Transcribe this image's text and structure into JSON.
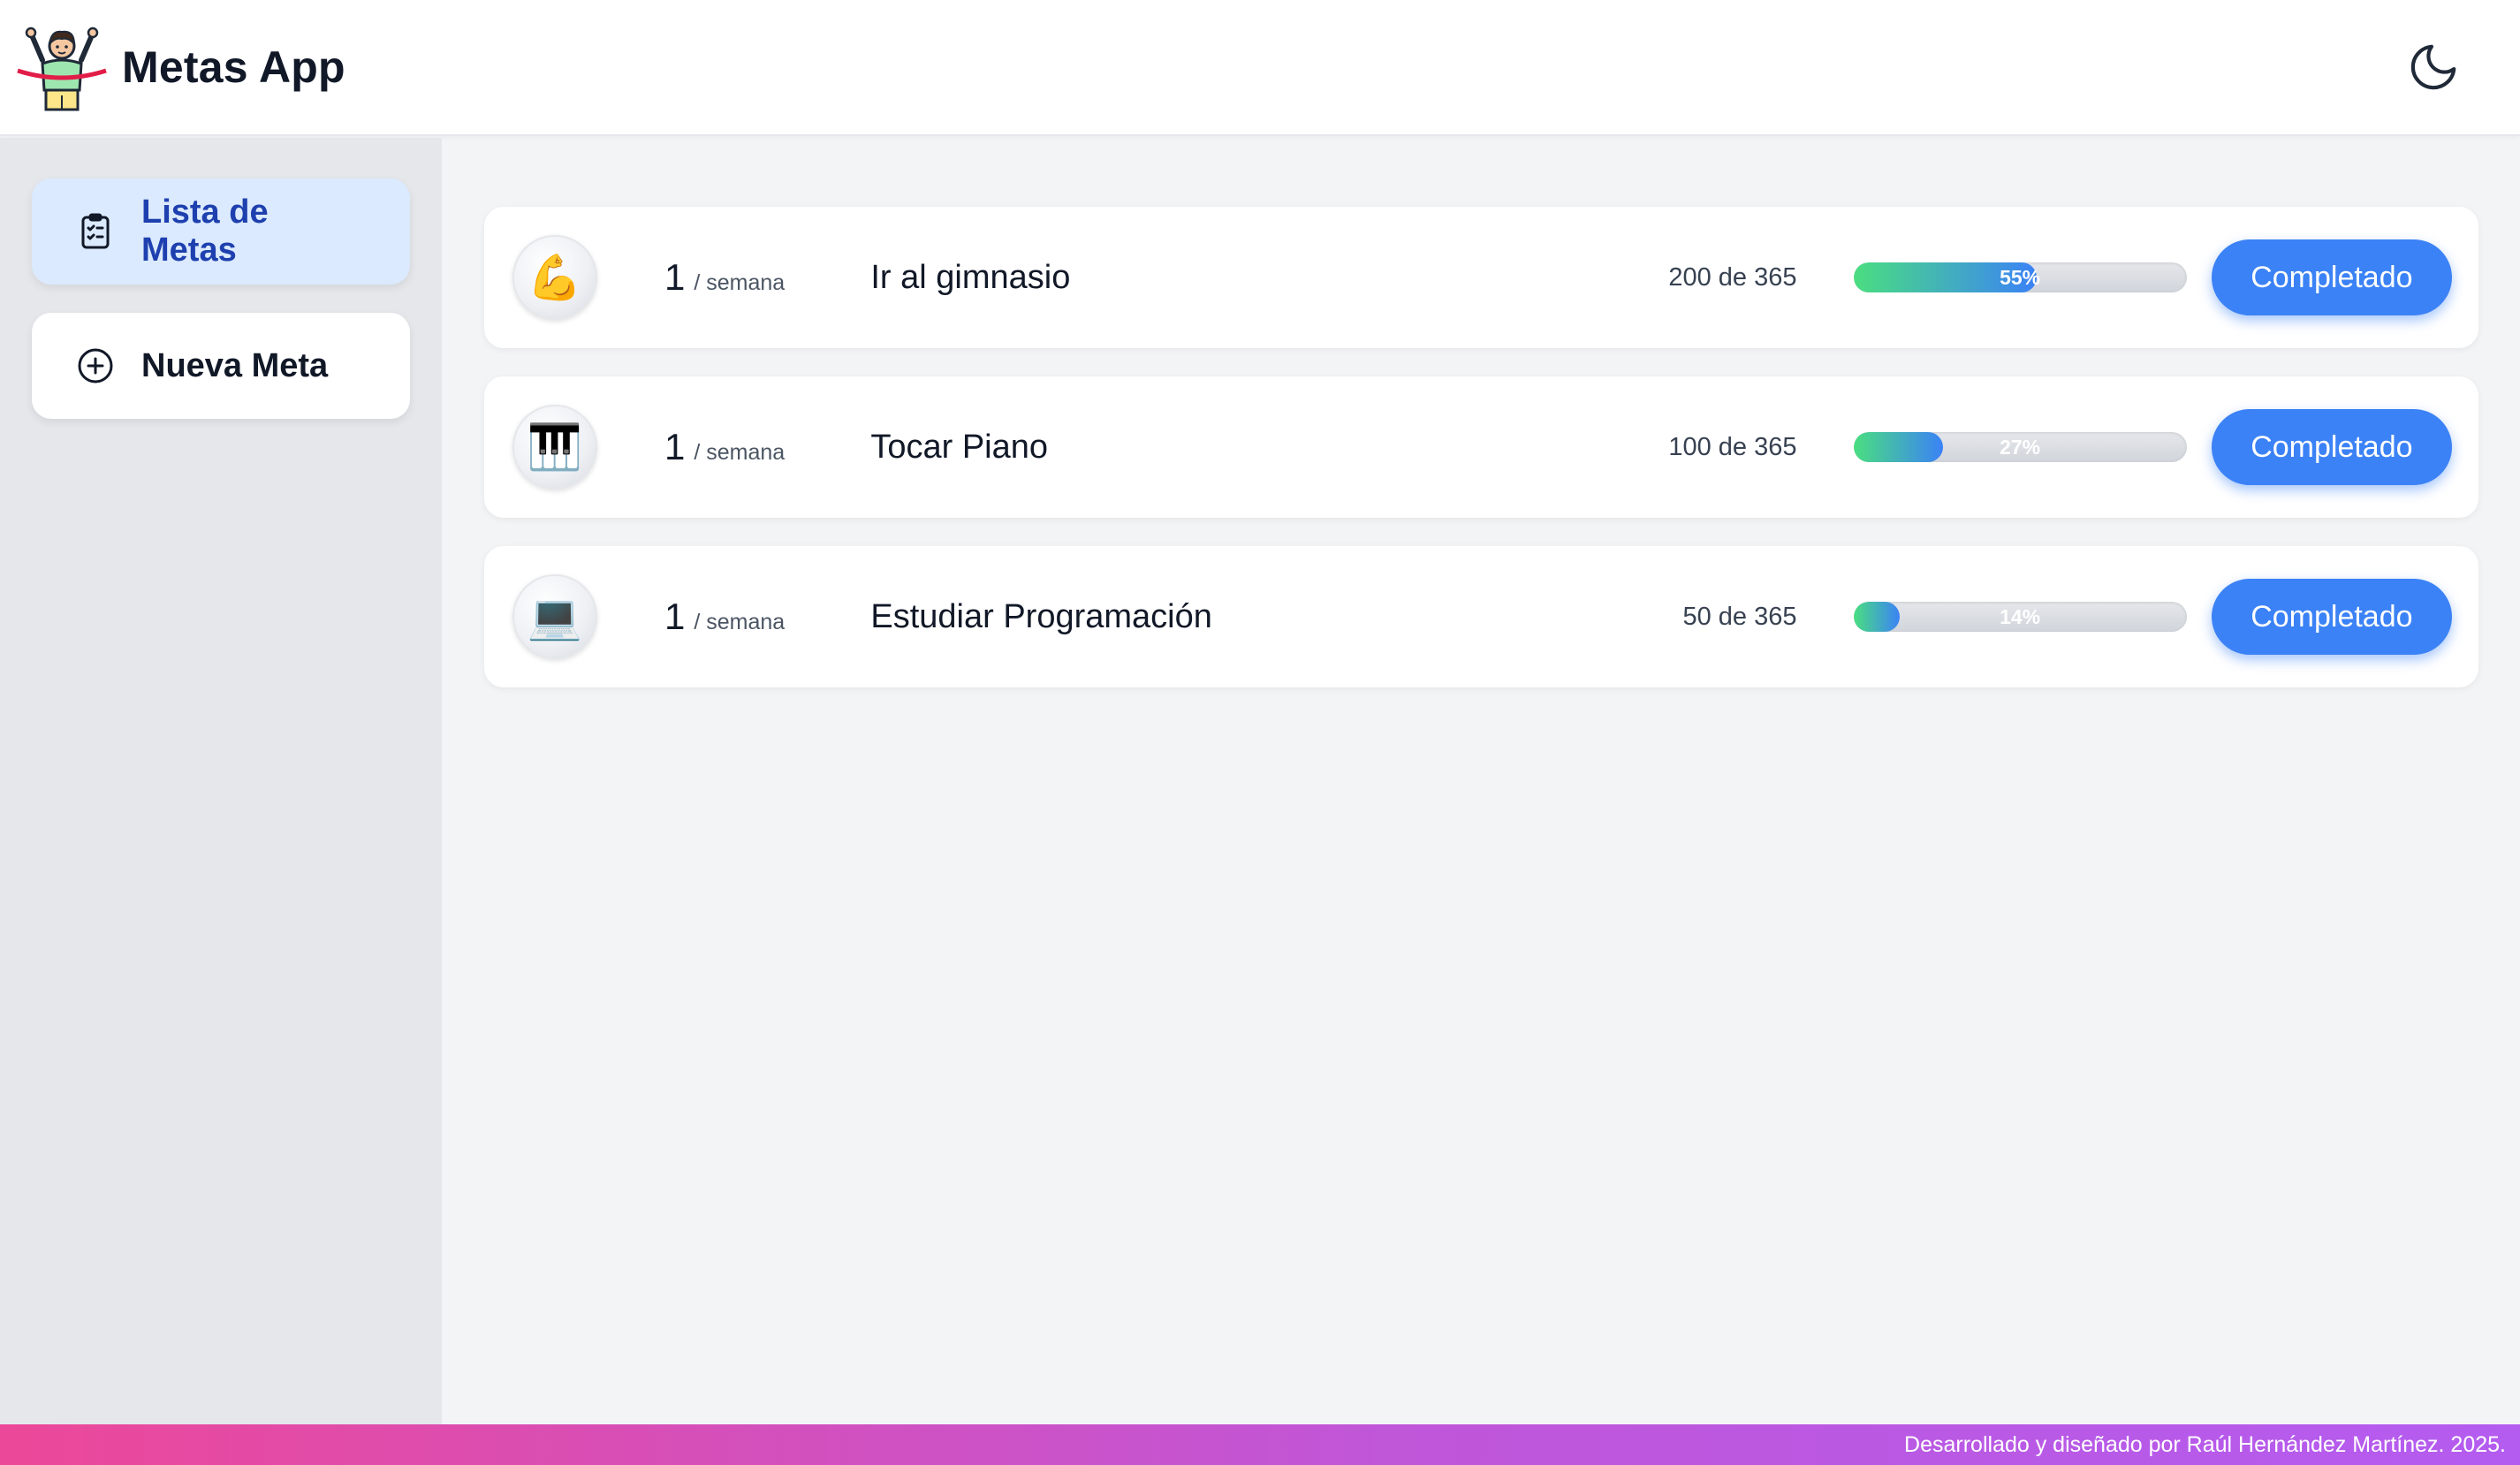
{
  "app": {
    "title": "Metas App"
  },
  "header": {
    "theme_toggle_icon": "moon-icon"
  },
  "sidebar": {
    "items": [
      {
        "label": "Lista de Metas",
        "icon": "clipboard-list-icon",
        "active": true
      },
      {
        "label": "Nueva Meta",
        "icon": "plus-circle-icon",
        "active": false
      }
    ]
  },
  "goals": [
    {
      "icon": "💪",
      "icon_name": "flexed-biceps-icon",
      "count": "1",
      "period": "/ semana",
      "title": "Ir al gimnasio",
      "progress_text": "200 de 365",
      "percent_label": "55%",
      "percent": 55,
      "button_label": "Completado"
    },
    {
      "icon": "🎹",
      "icon_name": "piano-icon",
      "count": "1",
      "period": "/ semana",
      "title": "Tocar Piano",
      "progress_text": "100 de 365",
      "percent_label": "27%",
      "percent": 27,
      "button_label": "Completado"
    },
    {
      "icon": "💻",
      "icon_name": "laptop-icon",
      "count": "1",
      "period": "/ semana",
      "title": "Estudiar Programación",
      "progress_text": "50 de 365",
      "percent_label": "14%",
      "percent": 14,
      "button_label": "Completado"
    }
  ],
  "footer": {
    "credit": "Desarrollado y diseñado por Raúl Hernández Martínez. 2025."
  },
  "colors": {
    "accent": "#3b82f6",
    "active_nav_bg": "#dbeafe",
    "active_nav_text": "#1e40af",
    "progress_start": "#4ade80",
    "progress_end": "#3b82f6",
    "footer_start": "#ec4899",
    "footer_end": "#b45cf0"
  }
}
